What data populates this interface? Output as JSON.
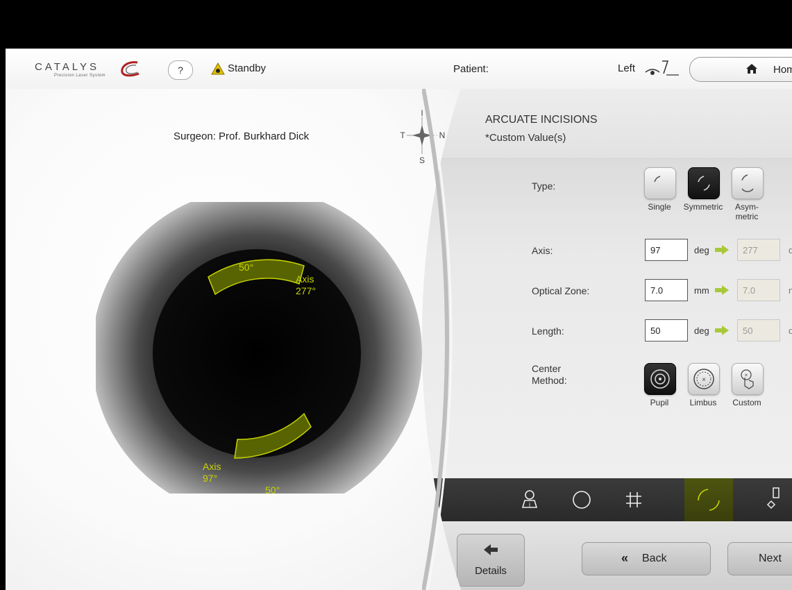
{
  "header": {
    "logo_text": "CATALYS",
    "logo_tagline": "Precision Laser System",
    "help_label": "?",
    "status": "Standby",
    "patient_label": "Patient:",
    "eye_label": "Left",
    "home_label": "Home"
  },
  "eye_view": {
    "surgeon": "Surgeon: Prof. Burkhard Dick",
    "compass": {
      "top": "I",
      "bottom": "S",
      "left": "T",
      "right": "N"
    },
    "incision_upper": {
      "length_label": "50°",
      "axis_label": "Axis",
      "axis_value": "277°"
    },
    "incision_lower": {
      "length_label": "50°",
      "axis_label": "Axis",
      "axis_value": "97°"
    }
  },
  "settings": {
    "title": "ARCUATE INCISIONS",
    "subtitle": "*Custom Value(s)",
    "type_label": "Type:",
    "type_options": [
      {
        "label": "Single",
        "selected": false
      },
      {
        "label": "Symmetric",
        "selected": true
      },
      {
        "label": "Asym-\nmetric",
        "selected": false
      }
    ],
    "axis": {
      "label": "Axis:",
      "value": "97",
      "unit": "deg",
      "mirror_value": "277",
      "mirror_unit": "d"
    },
    "optical_zone": {
      "label": "Optical Zone:",
      "value": "7.0",
      "unit": "mm",
      "mirror_value": "7.0",
      "mirror_unit": "n"
    },
    "length": {
      "label": "Length:",
      "value": "50",
      "unit": "deg",
      "mirror_value": "50",
      "mirror_unit": "d"
    },
    "center_method_label": "Center\nMethod:",
    "center_options": [
      {
        "label": "Pupil",
        "selected": true
      },
      {
        "label": "Limbus",
        "selected": false
      },
      {
        "label": "Custom",
        "selected": false
      }
    ]
  },
  "tabs": [
    {
      "icon": "patient-info-icon",
      "active": false
    },
    {
      "icon": "circle-icon",
      "active": false
    },
    {
      "icon": "grid-icon",
      "active": false
    },
    {
      "icon": "arcuate-icon",
      "active": true
    },
    {
      "icon": "marker-icon",
      "active": false
    }
  ],
  "bottom": {
    "details_label": "Details",
    "back_label": "Back",
    "back_icon": "«",
    "next_label": "Next"
  },
  "colors": {
    "accent_yellow": "#c8d400",
    "warning": "#e0c000",
    "brand_red": "#b02020"
  }
}
